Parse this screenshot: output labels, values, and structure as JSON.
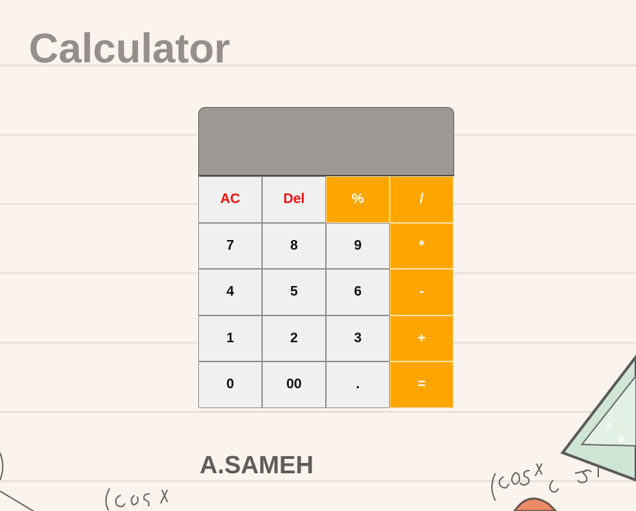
{
  "page": {
    "title": "Calculator",
    "author": "A.SAMEH"
  },
  "calculator": {
    "display_value": "",
    "keys": [
      {
        "label": "AC",
        "type": "red"
      },
      {
        "label": "Del",
        "type": "red"
      },
      {
        "label": "%",
        "type": "op"
      },
      {
        "label": "/",
        "type": "op"
      },
      {
        "label": "7",
        "type": "num"
      },
      {
        "label": "8",
        "type": "num"
      },
      {
        "label": "9",
        "type": "num"
      },
      {
        "label": "*",
        "type": "op"
      },
      {
        "label": "4",
        "type": "num"
      },
      {
        "label": "5",
        "type": "num"
      },
      {
        "label": "6",
        "type": "num"
      },
      {
        "label": "-",
        "type": "op"
      },
      {
        "label": "1",
        "type": "num"
      },
      {
        "label": "2",
        "type": "num"
      },
      {
        "label": "3",
        "type": "num"
      },
      {
        "label": "+",
        "type": "op"
      },
      {
        "label": "0",
        "type": "num"
      },
      {
        "label": "00",
        "type": "num"
      },
      {
        "label": ".",
        "type": "num"
      },
      {
        "label": "=",
        "type": "op"
      }
    ]
  },
  "colors": {
    "background": "#fbf3ee",
    "display": "#9c9894",
    "operator_key": "#ffa500",
    "number_key": "#f0f0f0",
    "clear_text": "#ee1111",
    "title_text": "#948f8c",
    "author_text": "#5f5c5a"
  }
}
